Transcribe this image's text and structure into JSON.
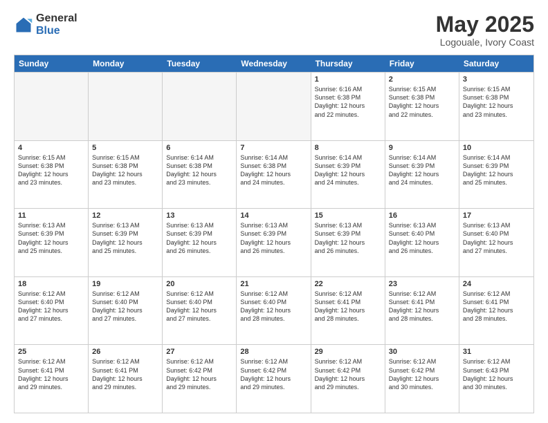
{
  "logo": {
    "general": "General",
    "blue": "Blue"
  },
  "title": "May 2025",
  "subtitle": "Logouale, Ivory Coast",
  "days": [
    "Sunday",
    "Monday",
    "Tuesday",
    "Wednesday",
    "Thursday",
    "Friday",
    "Saturday"
  ],
  "rows": [
    [
      {
        "day": "",
        "empty": true
      },
      {
        "day": "",
        "empty": true
      },
      {
        "day": "",
        "empty": true
      },
      {
        "day": "",
        "empty": true
      },
      {
        "day": "1",
        "text": "Sunrise: 6:16 AM\nSunset: 6:38 PM\nDaylight: 12 hours\nand 22 minutes."
      },
      {
        "day": "2",
        "text": "Sunrise: 6:15 AM\nSunset: 6:38 PM\nDaylight: 12 hours\nand 22 minutes."
      },
      {
        "day": "3",
        "text": "Sunrise: 6:15 AM\nSunset: 6:38 PM\nDaylight: 12 hours\nand 23 minutes."
      }
    ],
    [
      {
        "day": "4",
        "text": "Sunrise: 6:15 AM\nSunset: 6:38 PM\nDaylight: 12 hours\nand 23 minutes."
      },
      {
        "day": "5",
        "text": "Sunrise: 6:15 AM\nSunset: 6:38 PM\nDaylight: 12 hours\nand 23 minutes."
      },
      {
        "day": "6",
        "text": "Sunrise: 6:14 AM\nSunset: 6:38 PM\nDaylight: 12 hours\nand 23 minutes."
      },
      {
        "day": "7",
        "text": "Sunrise: 6:14 AM\nSunset: 6:38 PM\nDaylight: 12 hours\nand 24 minutes."
      },
      {
        "day": "8",
        "text": "Sunrise: 6:14 AM\nSunset: 6:39 PM\nDaylight: 12 hours\nand 24 minutes."
      },
      {
        "day": "9",
        "text": "Sunrise: 6:14 AM\nSunset: 6:39 PM\nDaylight: 12 hours\nand 24 minutes."
      },
      {
        "day": "10",
        "text": "Sunrise: 6:14 AM\nSunset: 6:39 PM\nDaylight: 12 hours\nand 25 minutes."
      }
    ],
    [
      {
        "day": "11",
        "text": "Sunrise: 6:13 AM\nSunset: 6:39 PM\nDaylight: 12 hours\nand 25 minutes."
      },
      {
        "day": "12",
        "text": "Sunrise: 6:13 AM\nSunset: 6:39 PM\nDaylight: 12 hours\nand 25 minutes."
      },
      {
        "day": "13",
        "text": "Sunrise: 6:13 AM\nSunset: 6:39 PM\nDaylight: 12 hours\nand 26 minutes."
      },
      {
        "day": "14",
        "text": "Sunrise: 6:13 AM\nSunset: 6:39 PM\nDaylight: 12 hours\nand 26 minutes."
      },
      {
        "day": "15",
        "text": "Sunrise: 6:13 AM\nSunset: 6:39 PM\nDaylight: 12 hours\nand 26 minutes."
      },
      {
        "day": "16",
        "text": "Sunrise: 6:13 AM\nSunset: 6:40 PM\nDaylight: 12 hours\nand 26 minutes."
      },
      {
        "day": "17",
        "text": "Sunrise: 6:13 AM\nSunset: 6:40 PM\nDaylight: 12 hours\nand 27 minutes."
      }
    ],
    [
      {
        "day": "18",
        "text": "Sunrise: 6:12 AM\nSunset: 6:40 PM\nDaylight: 12 hours\nand 27 minutes."
      },
      {
        "day": "19",
        "text": "Sunrise: 6:12 AM\nSunset: 6:40 PM\nDaylight: 12 hours\nand 27 minutes."
      },
      {
        "day": "20",
        "text": "Sunrise: 6:12 AM\nSunset: 6:40 PM\nDaylight: 12 hours\nand 27 minutes."
      },
      {
        "day": "21",
        "text": "Sunrise: 6:12 AM\nSunset: 6:40 PM\nDaylight: 12 hours\nand 28 minutes."
      },
      {
        "day": "22",
        "text": "Sunrise: 6:12 AM\nSunset: 6:41 PM\nDaylight: 12 hours\nand 28 minutes."
      },
      {
        "day": "23",
        "text": "Sunrise: 6:12 AM\nSunset: 6:41 PM\nDaylight: 12 hours\nand 28 minutes."
      },
      {
        "day": "24",
        "text": "Sunrise: 6:12 AM\nSunset: 6:41 PM\nDaylight: 12 hours\nand 28 minutes."
      }
    ],
    [
      {
        "day": "25",
        "text": "Sunrise: 6:12 AM\nSunset: 6:41 PM\nDaylight: 12 hours\nand 29 minutes."
      },
      {
        "day": "26",
        "text": "Sunrise: 6:12 AM\nSunset: 6:41 PM\nDaylight: 12 hours\nand 29 minutes."
      },
      {
        "day": "27",
        "text": "Sunrise: 6:12 AM\nSunset: 6:42 PM\nDaylight: 12 hours\nand 29 minutes."
      },
      {
        "day": "28",
        "text": "Sunrise: 6:12 AM\nSunset: 6:42 PM\nDaylight: 12 hours\nand 29 minutes."
      },
      {
        "day": "29",
        "text": "Sunrise: 6:12 AM\nSunset: 6:42 PM\nDaylight: 12 hours\nand 29 minutes."
      },
      {
        "day": "30",
        "text": "Sunrise: 6:12 AM\nSunset: 6:42 PM\nDaylight: 12 hours\nand 30 minutes."
      },
      {
        "day": "31",
        "text": "Sunrise: 6:12 AM\nSunset: 6:43 PM\nDaylight: 12 hours\nand 30 minutes."
      }
    ]
  ]
}
